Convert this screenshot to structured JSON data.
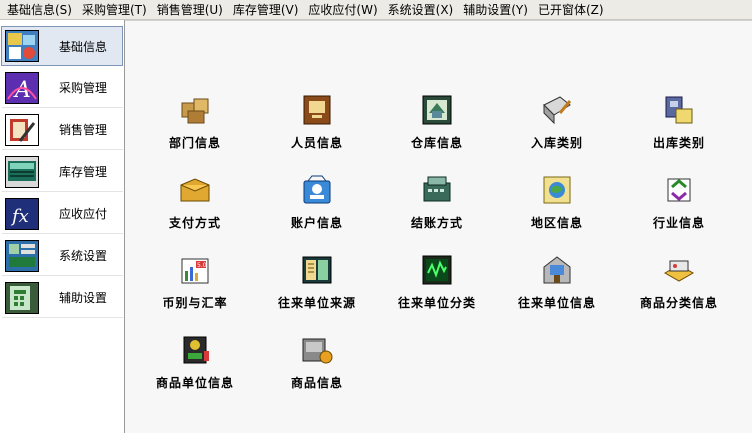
{
  "menubar": {
    "items": [
      "基础信息(S)",
      "采购管理(T)",
      "销售管理(U)",
      "库存管理(V)",
      "应收应付(W)",
      "系统设置(X)",
      "辅助设置(Y)",
      "已开窗体(Z)"
    ]
  },
  "sidebar": {
    "items": [
      {
        "label": "基础信息",
        "icon": "basic-info-icon",
        "active": true
      },
      {
        "label": "采购管理",
        "icon": "purchase-icon"
      },
      {
        "label": "销售管理",
        "icon": "sales-icon"
      },
      {
        "label": "库存管理",
        "icon": "inventory-icon"
      },
      {
        "label": "应收应付",
        "icon": "receivable-payable-icon"
      },
      {
        "label": "系统设置",
        "icon": "system-settings-icon"
      },
      {
        "label": "辅助设置",
        "icon": "auxiliary-settings-icon"
      }
    ]
  },
  "main": {
    "tiles": [
      {
        "label": "部门信息",
        "icon": "department-icon"
      },
      {
        "label": "人员信息",
        "icon": "personnel-icon"
      },
      {
        "label": "仓库信息",
        "icon": "warehouse-icon"
      },
      {
        "label": "入库类别",
        "icon": "inbound-category-icon"
      },
      {
        "label": "出库类别",
        "icon": "outbound-category-icon"
      },
      {
        "label": "支付方式",
        "icon": "payment-method-icon"
      },
      {
        "label": "账户信息",
        "icon": "account-icon"
      },
      {
        "label": "结账方式",
        "icon": "settlement-icon"
      },
      {
        "label": "地区信息",
        "icon": "region-icon"
      },
      {
        "label": "行业信息",
        "icon": "industry-icon"
      },
      {
        "label": "币别与汇率",
        "icon": "currency-rate-icon"
      },
      {
        "label": "往来单位来源",
        "icon": "partner-source-icon"
      },
      {
        "label": "往来单位分类",
        "icon": "partner-category-icon"
      },
      {
        "label": "往来单位信息",
        "icon": "partner-info-icon"
      },
      {
        "label": "商品分类信息",
        "icon": "product-category-icon"
      },
      {
        "label": "商品单位信息",
        "icon": "product-unit-icon"
      },
      {
        "label": "商品信息",
        "icon": "product-info-icon"
      }
    ]
  }
}
